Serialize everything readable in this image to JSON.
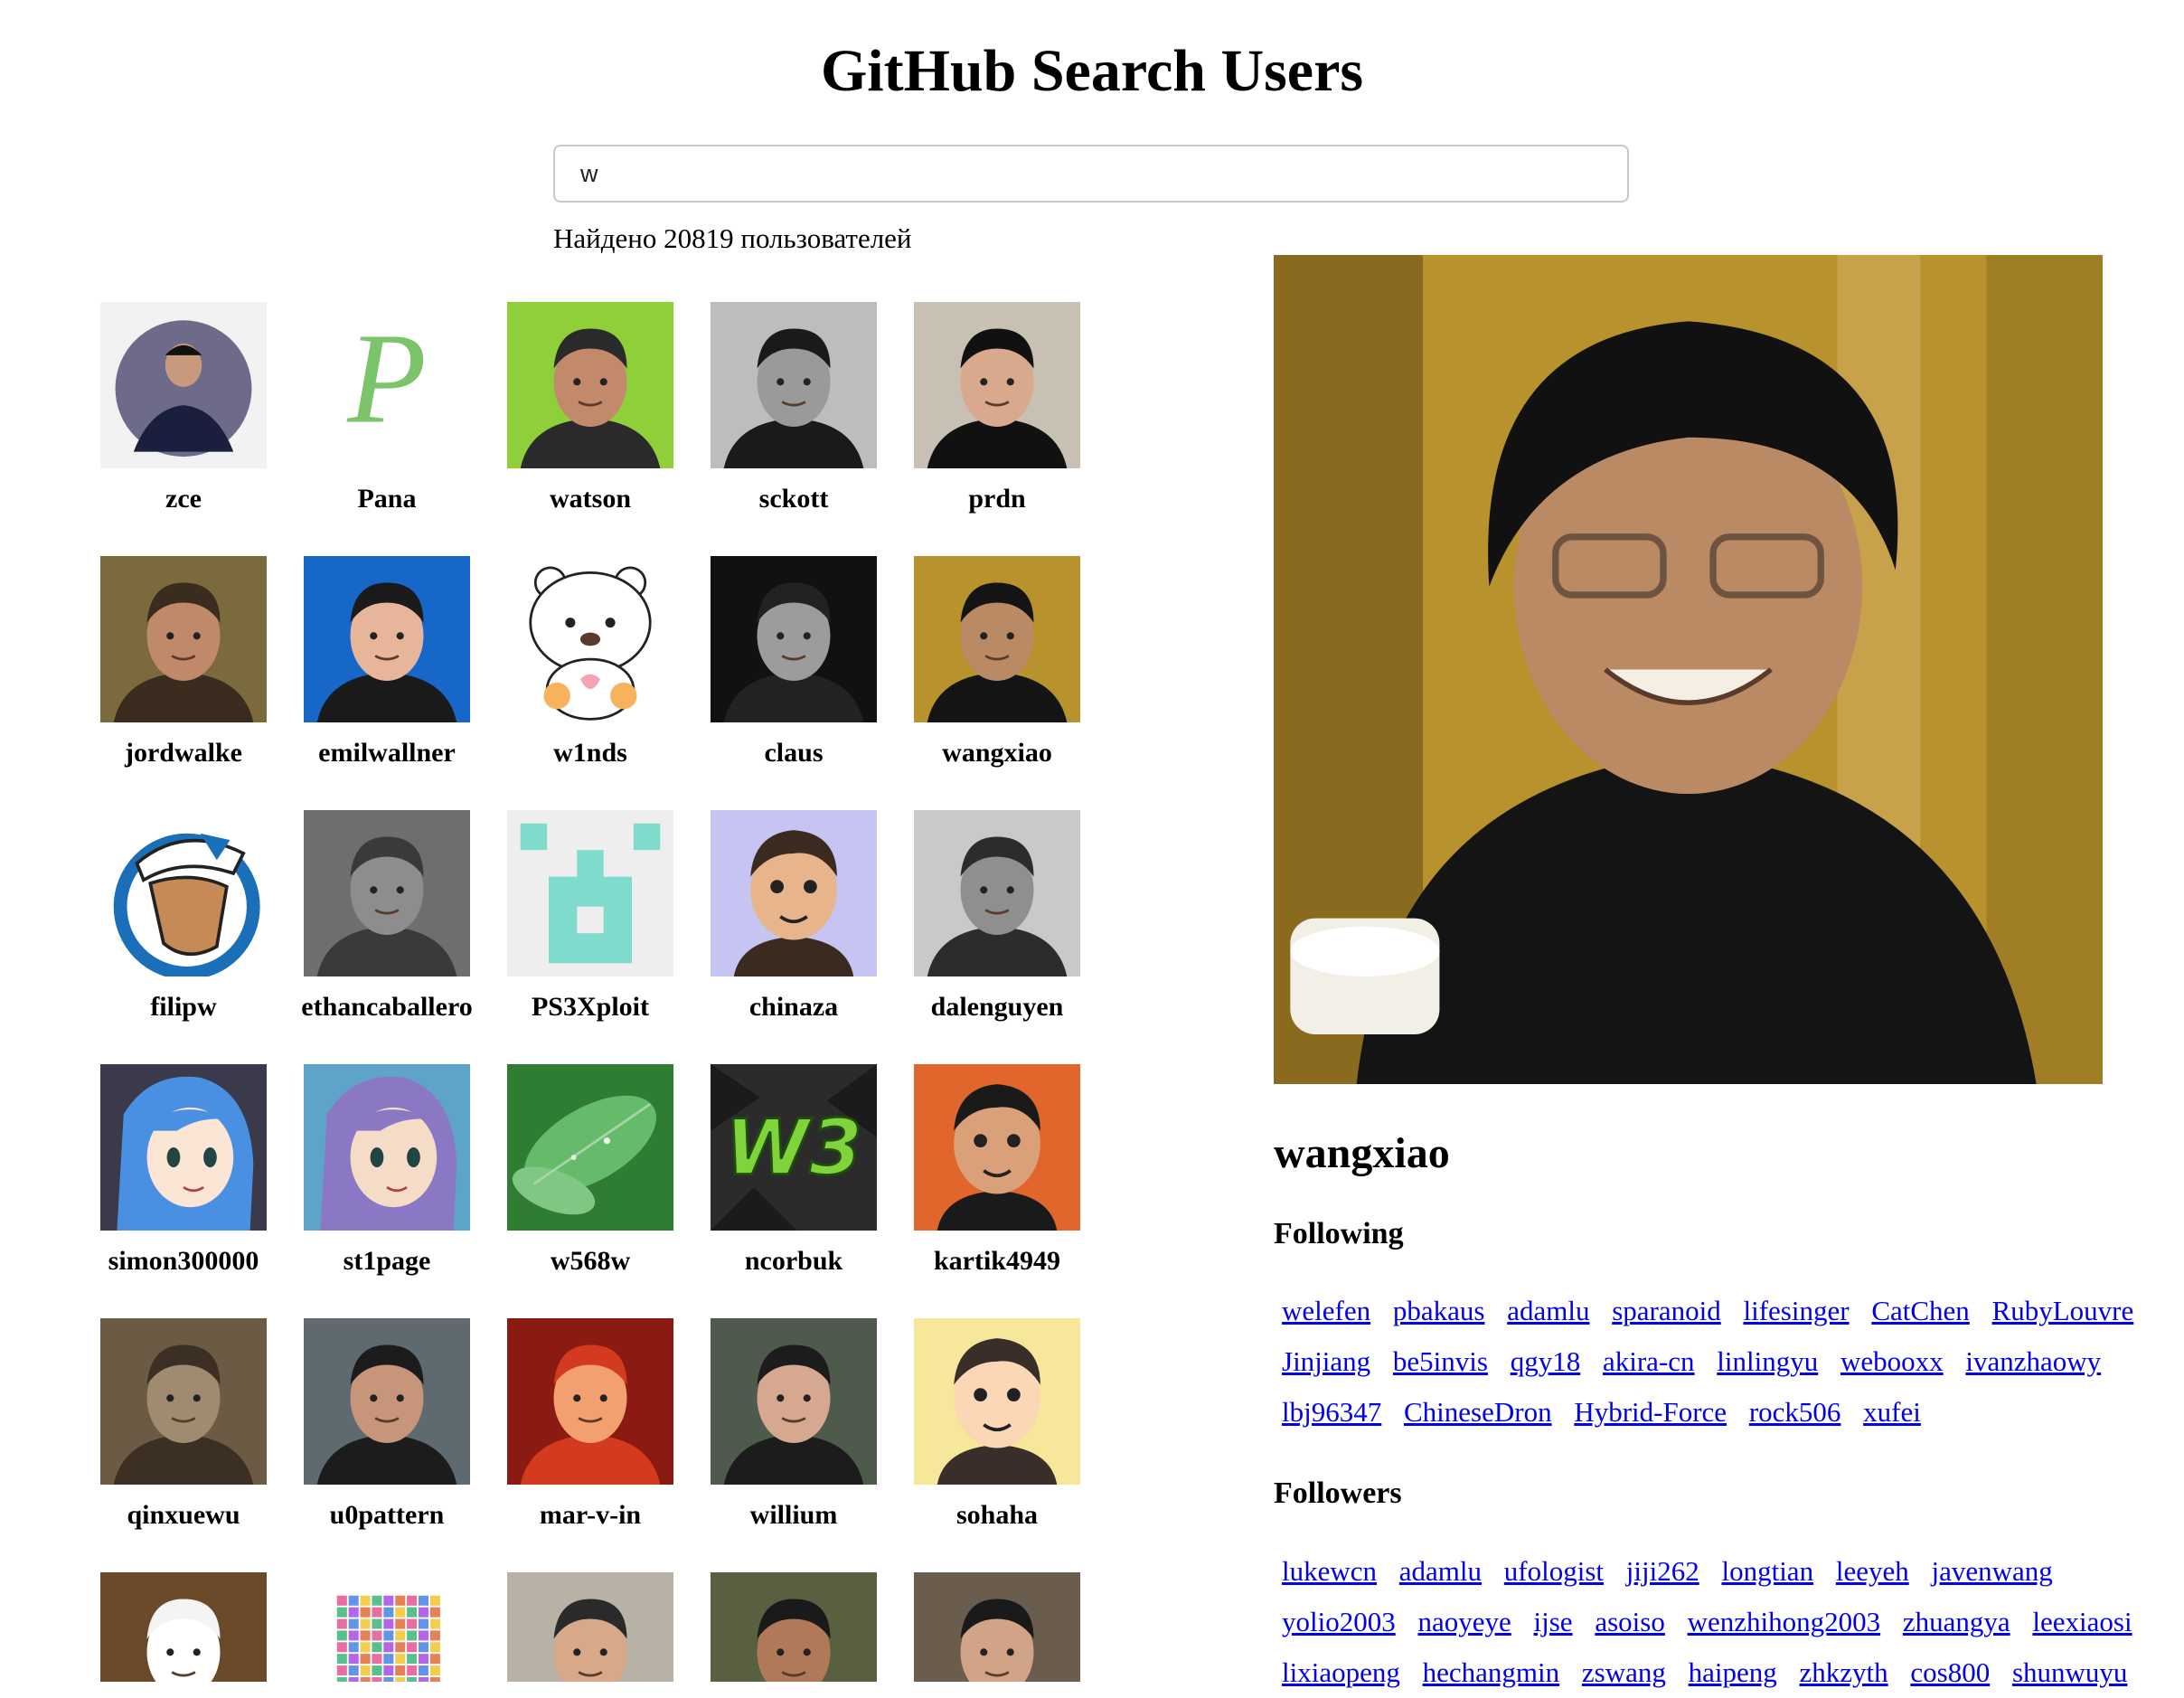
{
  "page_title": "GitHub Search Users",
  "search": {
    "value": "w"
  },
  "result_count_text": "Найдено 20819 пользователей",
  "users": [
    {
      "login": "zce",
      "avatar": {
        "kind": "photo-circle",
        "bg": "#f2f2f2",
        "fg": "#1a1f3d",
        "skin": "#c79a7e"
      }
    },
    {
      "login": "Pana",
      "avatar": {
        "kind": "letter-logo",
        "bg": "#ffffff",
        "fg": "#7cc46a",
        "glyph": "P"
      }
    },
    {
      "login": "watson",
      "avatar": {
        "kind": "photo",
        "bg": "#8fcf3a",
        "fg": "#2a2a2a",
        "skin": "#c28a6a"
      }
    },
    {
      "login": "sckott",
      "avatar": {
        "kind": "photo",
        "bg": "#bdbdbd",
        "fg": "#1a1a1a",
        "skin": "#9a9a9a"
      }
    },
    {
      "login": "prdn",
      "avatar": {
        "kind": "photo",
        "bg": "#c9c0b4",
        "fg": "#111111",
        "skin": "#d8a98c"
      }
    },
    {
      "login": "jordwalke",
      "avatar": {
        "kind": "photo",
        "bg": "#7b6a3c",
        "fg": "#3a2c1e",
        "skin": "#c08a6a"
      }
    },
    {
      "login": "emilwallner",
      "avatar": {
        "kind": "photo",
        "bg": "#1767c8",
        "fg": "#1a1a1a",
        "skin": "#e6b59a"
      }
    },
    {
      "login": "w1nds",
      "avatar": {
        "kind": "bear",
        "bg": "#ffffff",
        "fg": "#f6b25c",
        "skin": "#ffffff"
      }
    },
    {
      "login": "claus",
      "avatar": {
        "kind": "photo",
        "bg": "#111111",
        "fg": "#222222",
        "skin": "#9c9c9c"
      }
    },
    {
      "login": "wangxiao",
      "avatar": {
        "kind": "photo",
        "bg": "#b8922c",
        "fg": "#141414",
        "skin": "#b98a63"
      }
    },
    {
      "login": "filipw",
      "avatar": {
        "kind": "badge",
        "bg": "#ffffff",
        "fg": "#1b6fb8",
        "skin": "#c58a55"
      }
    },
    {
      "login": "ethancaballero",
      "avatar": {
        "kind": "photo",
        "bg": "#6e6e6e",
        "fg": "#3a3a3a",
        "skin": "#8d8d8d"
      }
    },
    {
      "login": "PS3Xploit",
      "avatar": {
        "kind": "identicon",
        "bg": "#eeeeee",
        "fg": "#7fdccc"
      }
    },
    {
      "login": "chinaza",
      "avatar": {
        "kind": "cartoon",
        "bg": "#c6c4f2",
        "fg": "#3b2a20",
        "skin": "#e7b48c"
      }
    },
    {
      "login": "dalenguyen",
      "avatar": {
        "kind": "photo",
        "bg": "#c9c9c9",
        "fg": "#2c2c2c",
        "skin": "#8f8f8f"
      }
    },
    {
      "login": "simon300000",
      "avatar": {
        "kind": "anime",
        "bg": "#3a3a4a",
        "fg": "#4a90e2",
        "skin": "#fbe6d6"
      }
    },
    {
      "login": "st1page",
      "avatar": {
        "kind": "anime",
        "bg": "#5ea4c8",
        "fg": "#8b78c4",
        "skin": "#f4dcc6"
      }
    },
    {
      "login": "w568w",
      "avatar": {
        "kind": "leaf",
        "bg": "#2e7d32",
        "fg": "#66bb6a"
      }
    },
    {
      "login": "ncorbuk",
      "avatar": {
        "kind": "logo-w3",
        "bg": "#2b2b2b",
        "fg": "#7fd33b",
        "glyph": "W3"
      }
    },
    {
      "login": "kartik4949",
      "avatar": {
        "kind": "cartoon",
        "bg": "#e0662c",
        "fg": "#1a1a1a",
        "skin": "#d9a07a"
      }
    },
    {
      "login": "qinxuewu",
      "avatar": {
        "kind": "photo",
        "bg": "#6b5a44",
        "fg": "#3c3024",
        "skin": "#a08a70"
      }
    },
    {
      "login": "u0pattern",
      "avatar": {
        "kind": "photo",
        "bg": "#5e6a70",
        "fg": "#1c1c1c",
        "skin": "#c6957a"
      }
    },
    {
      "login": "mar-v-in",
      "avatar": {
        "kind": "photo",
        "bg": "#8a1a12",
        "fg": "#d33a1e",
        "skin": "#f3a070"
      }
    },
    {
      "login": "willium",
      "avatar": {
        "kind": "photo",
        "bg": "#4e5a4c",
        "fg": "#1c1c1c",
        "skin": "#d6a890"
      }
    },
    {
      "login": "sohaha",
      "avatar": {
        "kind": "cartoon",
        "bg": "#f7e79a",
        "fg": "#3a2e2a",
        "skin": "#fcd7b6"
      }
    },
    {
      "login": "",
      "avatar": {
        "kind": "photo",
        "bg": "#6b4a2a",
        "fg": "#f4f4f4",
        "skin": "#ffffff"
      }
    },
    {
      "login": "",
      "avatar": {
        "kind": "noise",
        "bg": "#ffffff",
        "fg": "#e04a8c"
      }
    },
    {
      "login": "",
      "avatar": {
        "kind": "photo",
        "bg": "#b8b1a6",
        "fg": "#2a2a2a",
        "skin": "#d7a988"
      }
    },
    {
      "login": "",
      "avatar": {
        "kind": "photo",
        "bg": "#586040",
        "fg": "#1a1a1a",
        "skin": "#b07a58"
      }
    },
    {
      "login": "",
      "avatar": {
        "kind": "photo",
        "bg": "#6b5d4d",
        "fg": "#1a1a1a",
        "skin": "#d2a487"
      }
    }
  ],
  "details": {
    "login": "wangxiao",
    "following_heading": "Following",
    "followers_heading": "Followers",
    "following": [
      "welefen",
      "pbakaus",
      "adamlu",
      "sparanoid",
      "lifesinger",
      "CatChen",
      "RubyLouvre",
      "Jinjiang",
      "be5invis",
      "qgy18",
      "akira-cn",
      "linlingyu",
      "webooxx",
      "ivanzhaowy",
      "lbj96347",
      "ChineseDron",
      "Hybrid-Force",
      "rock506",
      "xufei"
    ],
    "followers": [
      "lukewcn",
      "adamlu",
      "ufologist",
      "jiji262",
      "longtian",
      "leeyeh",
      "javenwang",
      "yolio2003",
      "naoyeye",
      "ijse",
      "asoiso",
      "wenzhihong2003",
      "zhuangya",
      "leexiaosi",
      "lixiaopeng",
      "hechangmin",
      "zswang",
      "haipeng",
      "zhkzyth",
      "cos800",
      "shunwuyu"
    ]
  },
  "colors": {
    "link": "#0000ee",
    "input_border": "#c8c8c8"
  }
}
